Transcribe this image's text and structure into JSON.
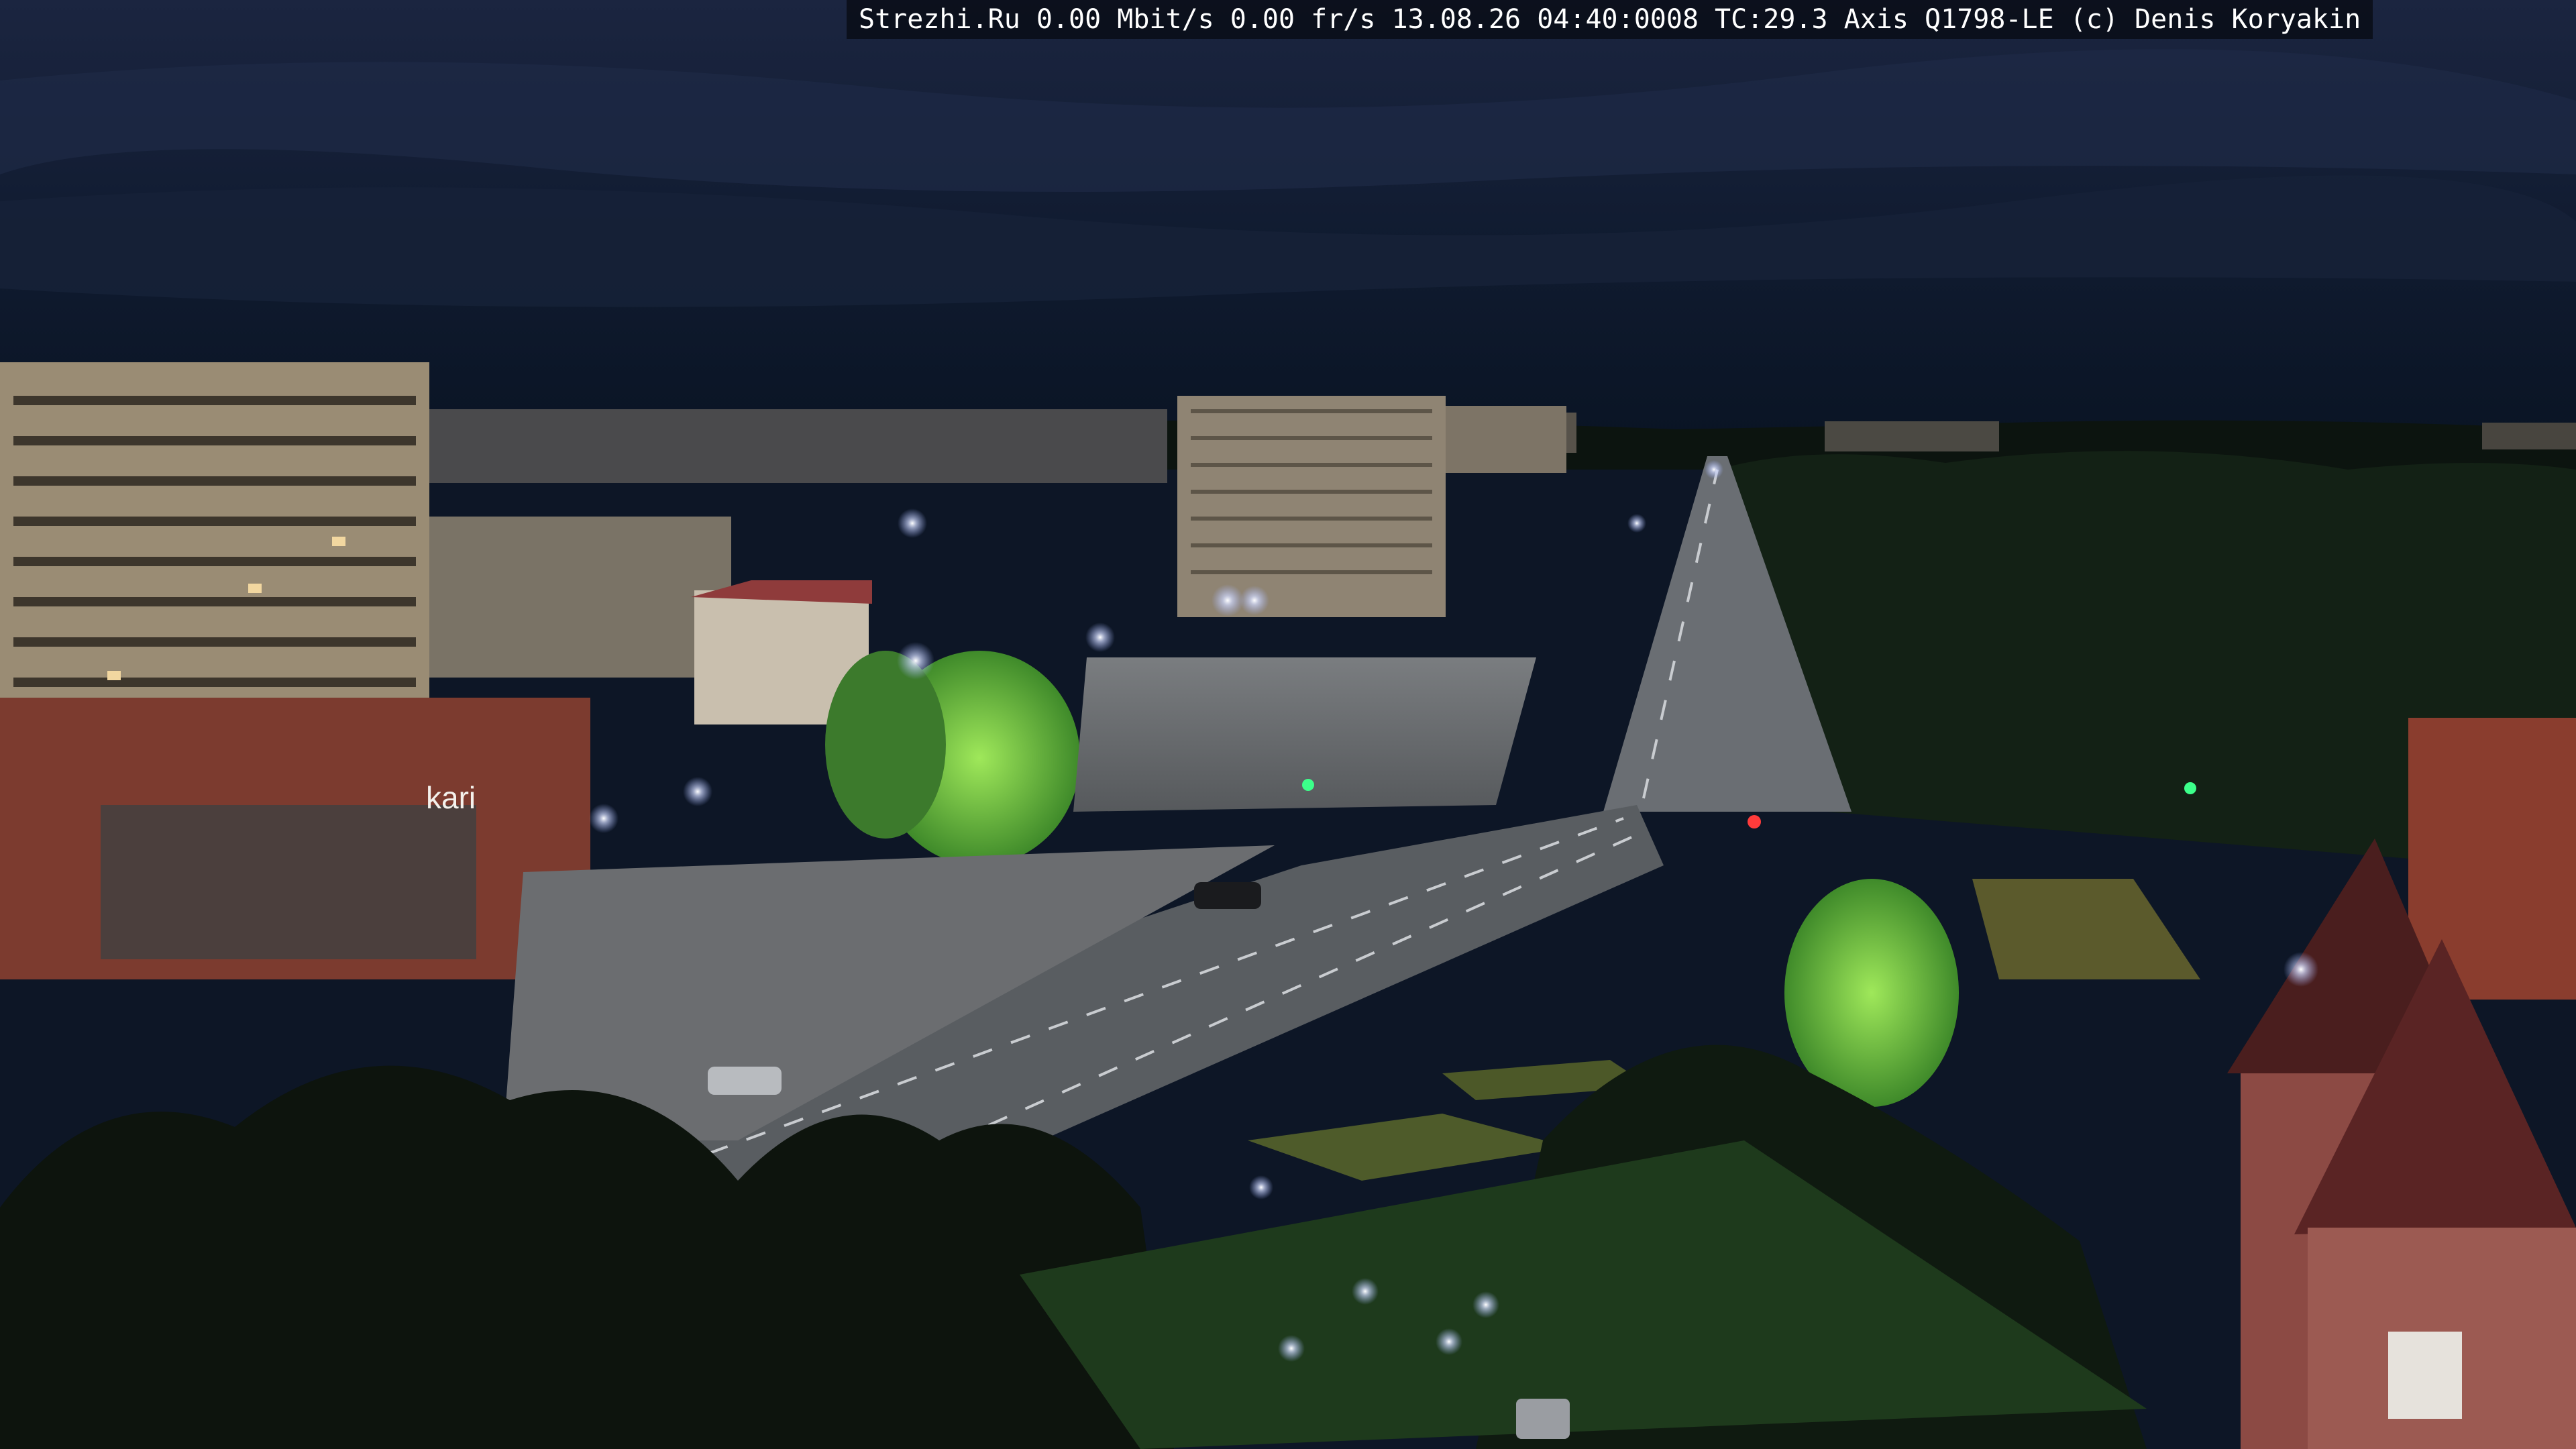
{
  "camera_overlay": {
    "site": "Strezhi.Ru",
    "bitrate": "0.00 Mbit/s",
    "framerate": "0.00 fr/s",
    "datetime": "13.08.26 04:40:0008",
    "tc": "TC:29.3",
    "camera_model": "Axis Q1798-LE",
    "copyright": "(c) Denis Koryakin"
  },
  "signage": {
    "store_sign": "kari"
  },
  "colors": {
    "sky_top": "#1a2438",
    "sky_horizon": "#0b1526",
    "road": "#5a5e63",
    "street_light": "#e8eeff",
    "foliage_lit": "#6fcf3f",
    "foliage_dark": "#0f1a10",
    "building_facade": "#a89a80",
    "brick_red": "#8a3d2e"
  }
}
